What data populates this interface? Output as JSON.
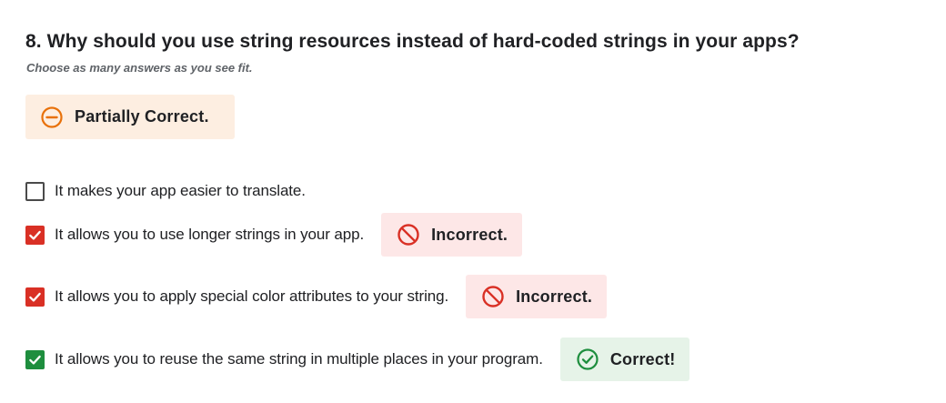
{
  "question": {
    "title": "8. Why should you use string resources instead of hard-coded strings in your apps?",
    "hint": "Choose as many answers as you see fit."
  },
  "overall_result": {
    "label": "Partially Correct.",
    "icon": "minus-circle-icon",
    "color": "#e8710a",
    "background": "#fdeee1"
  },
  "options": [
    {
      "label": "It makes your app easier to translate.",
      "checked": false,
      "feedback": null
    },
    {
      "label": "It allows you to use longer strings in your app.",
      "checked": true,
      "feedback": {
        "label": "Incorrect.",
        "icon": "prohibited-icon",
        "color": "#d93025"
      }
    },
    {
      "label": "It allows you to apply special color attributes to your string.",
      "checked": true,
      "feedback": {
        "label": "Incorrect.",
        "icon": "prohibited-icon",
        "color": "#d93025"
      }
    },
    {
      "label": "It allows you to reuse the same string in multiple places in your program.",
      "checked": true,
      "feedback": {
        "label": "Correct!",
        "icon": "check-circle-icon",
        "color": "#1e8e3e"
      }
    }
  ],
  "colors": {
    "incorrect_bg": "#fde7e7",
    "correct_bg": "#e6f3e8",
    "checkbox_red": "#d93025",
    "checkbox_green": "#1e8e3e"
  }
}
